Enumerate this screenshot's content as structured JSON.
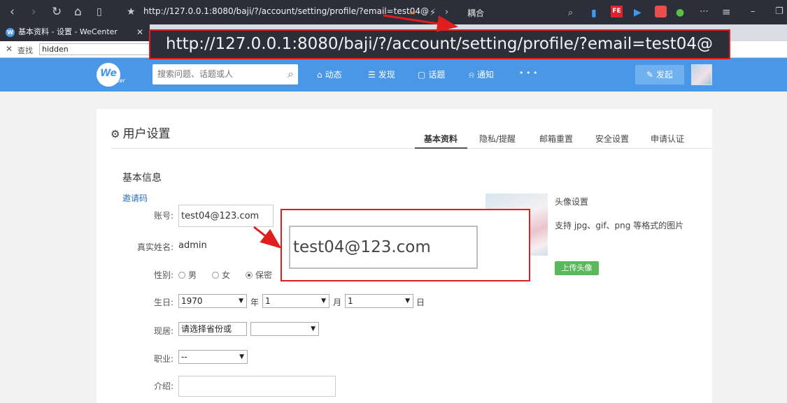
{
  "browser": {
    "address": "http://127.0.0.1:8080/baji/?/account/setting/profile/?email=test04@",
    "tab_title": "基本资料 - 设置 - WeCenter",
    "extension_label": "耦合",
    "find_label": "查找",
    "find_value": "hidden"
  },
  "site": {
    "logo_text": "We",
    "logo_sub": "Center",
    "search_placeholder": "搜索问题、话题或人",
    "nav": [
      "动态",
      "发现",
      "话题",
      "通知",
      "• • •"
    ],
    "publish_label": "发起"
  },
  "settings": {
    "title": "用户设置",
    "tabs": [
      "基本资料",
      "隐私/提醒",
      "邮箱重置",
      "安全设置",
      "申请认证"
    ],
    "active_tab": "基本资料",
    "section_title": "基本信息",
    "invite_link": "邀请码",
    "fields": {
      "account_label": "账号:",
      "account_value": "test04@123.com",
      "realname_label": "真实姓名:",
      "realname_value": "admin",
      "gender_label": "性别:",
      "gender_options": [
        "男",
        "女",
        "保密"
      ],
      "gender_selected": "保密",
      "birthday_label": "生日:",
      "birth_year": "1970",
      "year_unit": "年",
      "birth_month": "1",
      "month_unit": "月",
      "birth_day": "1",
      "day_unit": "日",
      "residence_label": "现居:",
      "province_placeholder": "请选择省份或",
      "city_value": "",
      "job_label": "职业:",
      "job_value": "--",
      "intro_label": "介绍:"
    },
    "avatar": {
      "title": "头像设置",
      "desc": "支持 jpg、gif、png 等格式的图片",
      "upload_label": "上传头像"
    }
  },
  "annotations": {
    "url_zoom": "http://127.0.0.1:8080/baji/?/account/setting/profile/?email=test04@",
    "email_zoom": "test04@123.com",
    "color": "#e01e1e"
  }
}
